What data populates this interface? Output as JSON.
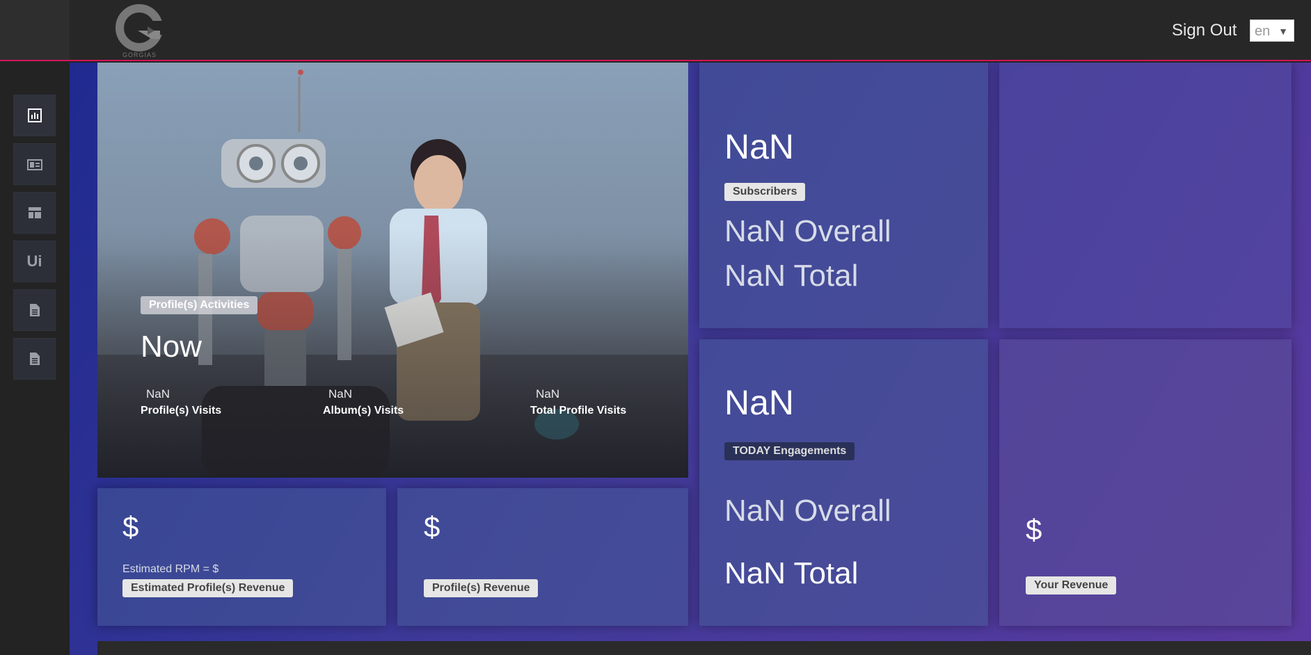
{
  "header": {
    "logo_text": "GORGIAS",
    "sign_out": "Sign Out",
    "language": "en"
  },
  "sidebar": {
    "items": [
      {
        "name": "dashboard",
        "icon": "bar-chart-icon"
      },
      {
        "name": "gallery",
        "icon": "gallery-icon"
      },
      {
        "name": "layout",
        "icon": "layout-icon"
      },
      {
        "name": "ui",
        "label": "Ui"
      },
      {
        "name": "document-1",
        "icon": "document-icon"
      },
      {
        "name": "document-2",
        "icon": "document-icon"
      }
    ]
  },
  "hero": {
    "badge": "Profile(s) Activities",
    "title": "Now",
    "stats": [
      {
        "value": "NaN",
        "label": "Profile(s) Visits"
      },
      {
        "value": "NaN",
        "label": "Album(s) Visits"
      },
      {
        "value": "NaN",
        "label": "Total Profile Visits"
      }
    ]
  },
  "subscribers_card": {
    "value": "NaN",
    "badge": "Subscribers",
    "overall": "NaN Overall",
    "total": "NaN Total"
  },
  "engagements_card": {
    "value": "NaN",
    "badge": "TODAY Engagements",
    "overall": "NaN Overall",
    "total": "NaN Total"
  },
  "estimated_revenue_card": {
    "amount": "$",
    "rpm": "Estimated RPM = $",
    "badge": "Estimated Profile(s) Revenue"
  },
  "profile_revenue_card": {
    "amount": "$",
    "badge": "Profile(s) Revenue"
  },
  "your_revenue_card": {
    "amount": "$",
    "badge": "Your Revenue"
  },
  "colors": {
    "accent_line": "#d4145a",
    "topbar": "#272727",
    "sidebar": "#232323"
  }
}
